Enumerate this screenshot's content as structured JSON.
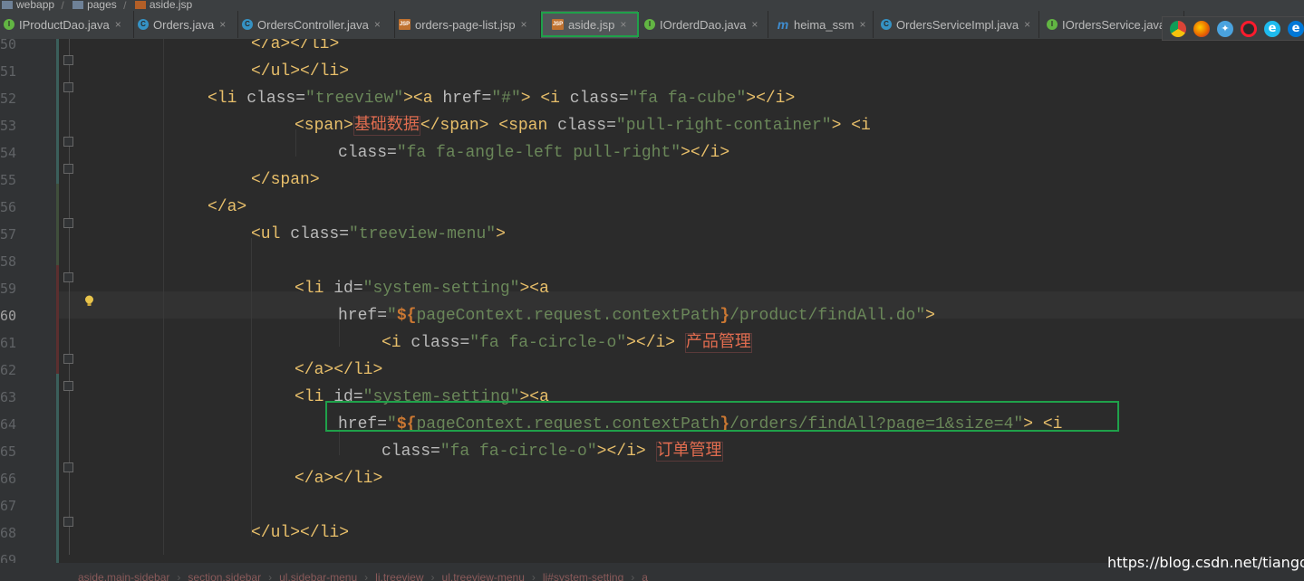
{
  "breadcrumb": {
    "items": [
      {
        "label": "webapp",
        "icon": "folder-icon"
      },
      {
        "label": "pages",
        "icon": "folder-icon"
      },
      {
        "label": "aside.jsp",
        "icon": "jsp-file-icon"
      }
    ]
  },
  "tabs": [
    {
      "label": "IProductDao.java",
      "icon": "interface-icon",
      "active": false
    },
    {
      "label": "Orders.java",
      "icon": "class-icon",
      "active": false
    },
    {
      "label": "OrdersController.java",
      "icon": "class-icon",
      "active": false
    },
    {
      "label": "orders-page-list.jsp",
      "icon": "jsp-icon",
      "active": false
    },
    {
      "label": "aside.jsp",
      "icon": "jsp-icon",
      "active": true
    },
    {
      "label": "IOrderdDao.java",
      "icon": "interface-icon",
      "active": false
    },
    {
      "label": "heima_ssm",
      "icon": "module-icon",
      "active": false
    },
    {
      "label": "OrdersServiceImpl.java",
      "icon": "class-icon",
      "active": false
    },
    {
      "label": "IOrdersService.java",
      "icon": "interface-icon",
      "active": false
    }
  ],
  "tab_close_glyph": "×",
  "tab_icon_glyphs": {
    "interface": "I",
    "class": "C",
    "jsp": "JSP",
    "module": "m"
  },
  "browser_icons": [
    "chrome-icon",
    "firefox-icon",
    "safari-icon",
    "opera-icon",
    "ie-icon",
    "edge-icon"
  ],
  "editor": {
    "current_line": "60",
    "lines": [
      {
        "num": "50",
        "text": "</a></li>"
      },
      {
        "num": "51",
        "text": "</ul></li>"
      },
      {
        "num": "52",
        "text": "<li class=\"treeview\"><a href=\"#\"> <i class=\"fa fa-cube\"></i>"
      },
      {
        "num": "53",
        "text": "<span>基础数据</span> <span class=\"pull-right-container\"> <i"
      },
      {
        "num": "54",
        "text": "class=\"fa fa-angle-left pull-right\"></i>"
      },
      {
        "num": "55",
        "text": "</span>"
      },
      {
        "num": "56",
        "text": "</a>"
      },
      {
        "num": "57",
        "text": "<ul class=\"treeview-menu\">"
      },
      {
        "num": "58",
        "text": ""
      },
      {
        "num": "59",
        "text": "<li id=\"system-setting\"><a"
      },
      {
        "num": "60",
        "text": "href=\"${pageContext.request.contextPath}/product/findAll.do\">"
      },
      {
        "num": "61",
        "text": "<i class=\"fa fa-circle-o\"></i> 产品管理"
      },
      {
        "num": "62",
        "text": "</a></li>"
      },
      {
        "num": "63",
        "text": "<li id=\"system-setting\"><a"
      },
      {
        "num": "64",
        "text": "href=\"${pageContext.request.contextPath}/orders/findAll?page=1&size=4\"> <i"
      },
      {
        "num": "65",
        "text": "class=\"fa fa-circle-o\"></i> 订单管理"
      },
      {
        "num": "66",
        "text": "</a></li>"
      },
      {
        "num": "67",
        "text": ""
      },
      {
        "num": "68",
        "text": "</ul></li>"
      },
      {
        "num": "69",
        "text": ""
      }
    ]
  },
  "statusbar": {
    "crumbs": [
      "aside.main-sidebar",
      "section.sidebar",
      "ul.sidebar-menu",
      "li.treeview",
      "ul.treeview-menu",
      "li#system-setting",
      "a"
    ],
    "separator": "›"
  },
  "watermark": "https://blog.csdn.net/tiangoua",
  "colors": {
    "tag": "#e8bf6a",
    "string": "#6a8759",
    "attribute": "#bababa",
    "el_expression": "#cc7832",
    "chinese_text": "#e06c4f",
    "highlight_box": "#1fa14a"
  }
}
